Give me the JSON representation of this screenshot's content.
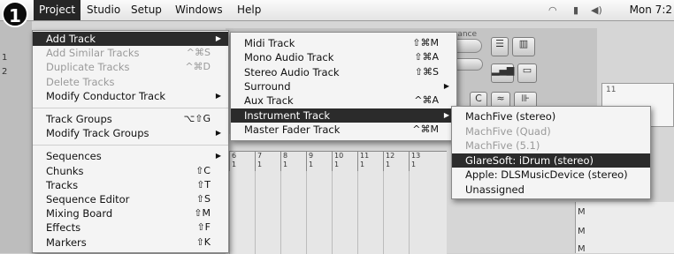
{
  "step_badge": "1",
  "menubar": {
    "items": [
      "Project",
      "Studio",
      "Setup",
      "Windows",
      "Help"
    ],
    "clock": "Mon 7:2"
  },
  "background": {
    "toolbar_label": "rmance",
    "ruler_numbers": [
      "6",
      "7",
      "8",
      "9",
      "10",
      "11",
      "12",
      "13"
    ],
    "ruler_sub": "1",
    "timeline_mark": "11",
    "side_letters": [
      "M",
      "M",
      "M"
    ]
  },
  "project_menu": [
    {
      "label": "Add Track",
      "shortcut": "",
      "submenu": true,
      "state": "highlighted"
    },
    {
      "label": "Add Similar Tracks",
      "shortcut": "^⌘S",
      "submenu": false,
      "state": "disabled"
    },
    {
      "label": "Duplicate Tracks",
      "shortcut": "^⌘D",
      "submenu": false,
      "state": "disabled"
    },
    {
      "label": "Delete Tracks",
      "shortcut": "",
      "submenu": false,
      "state": "disabled"
    },
    {
      "label": "Modify Conductor Track",
      "shortcut": "",
      "submenu": true,
      "state": "normal"
    },
    {
      "separator": true
    },
    {
      "label": "Track Groups",
      "shortcut": "⌥⇧G",
      "submenu": false,
      "state": "normal"
    },
    {
      "label": "Modify Track Groups",
      "shortcut": "",
      "submenu": true,
      "state": "normal"
    },
    {
      "separator": true
    },
    {
      "label": "Sequences",
      "shortcut": "",
      "submenu": true,
      "state": "normal"
    },
    {
      "label": "Chunks",
      "shortcut": "⇧C",
      "submenu": false,
      "state": "normal"
    },
    {
      "label": "Tracks",
      "shortcut": "⇧T",
      "submenu": false,
      "state": "normal"
    },
    {
      "label": "Sequence Editor",
      "shortcut": "⇧S",
      "submenu": false,
      "state": "normal"
    },
    {
      "label": "Mixing Board",
      "shortcut": "⇧M",
      "submenu": false,
      "state": "normal"
    },
    {
      "label": "Effects",
      "shortcut": "⇧F",
      "submenu": false,
      "state": "normal"
    },
    {
      "label": "Markers",
      "shortcut": "⇧K",
      "submenu": false,
      "state": "normal"
    }
  ],
  "add_track_menu": [
    {
      "label": "Midi Track",
      "shortcut": "⇧⌘M",
      "submenu": false,
      "state": "normal"
    },
    {
      "label": "Mono Audio Track",
      "shortcut": "⇧⌘A",
      "submenu": false,
      "state": "normal"
    },
    {
      "label": "Stereo Audio Track",
      "shortcut": "⇧⌘S",
      "submenu": false,
      "state": "normal"
    },
    {
      "label": "Surround",
      "shortcut": "",
      "submenu": true,
      "state": "normal"
    },
    {
      "label": "Aux Track",
      "shortcut": "^⌘A",
      "submenu": false,
      "state": "normal"
    },
    {
      "label": "Instrument Track",
      "shortcut": "",
      "submenu": true,
      "state": "highlighted"
    },
    {
      "label": "Master Fader Track",
      "shortcut": "^⌘M",
      "submenu": false,
      "state": "normal"
    }
  ],
  "instrument_menu": [
    {
      "label": "MachFive (stereo)",
      "state": "normal"
    },
    {
      "label": "MachFive (Quad)",
      "state": "disabled"
    },
    {
      "label": "MachFive (5.1)",
      "state": "disabled"
    },
    {
      "label": "GlareSoft: iDrum (stereo)",
      "state": "highlighted"
    },
    {
      "label": "Apple: DLSMusicDevice (stereo)",
      "state": "normal"
    },
    {
      "label": "Unassigned",
      "state": "normal"
    }
  ]
}
